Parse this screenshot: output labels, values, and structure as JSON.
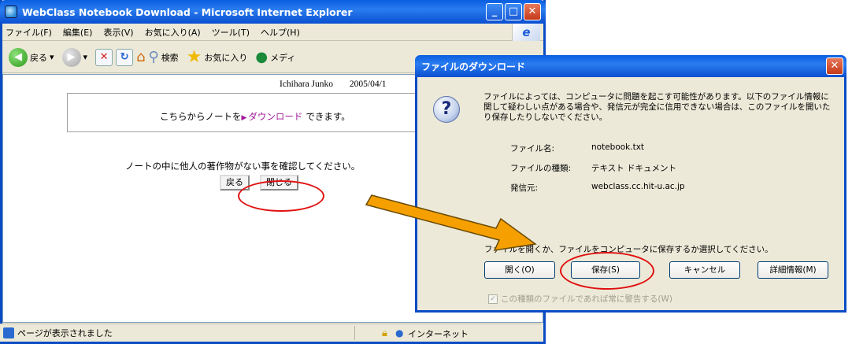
{
  "ie_window": {
    "title": "WebClass Notebook Download - Microsoft Internet Explorer",
    "menu": [
      "ファイル(F)",
      "編集(E)",
      "表示(V)",
      "お気に入り(A)",
      "ツール(T)",
      "ヘルプ(H)"
    ],
    "toolbar": {
      "back_label": "戻る",
      "search_label": "検索",
      "favorites_label": "お気に入り",
      "media_label": "メディ"
    },
    "content": {
      "user_name": "Ichihara Junko",
      "date": "2005/04/1",
      "note_prefix": "こちらからノートを",
      "download_link": "ダウンロード",
      "note_suffix": "できます。",
      "instruction": "ノートの中に他人の著作物がない事を確認してください。",
      "back_button": "戻る",
      "close_button": "閉じる"
    },
    "status": {
      "message": "ページが表示されました",
      "zone": "インターネット"
    }
  },
  "download_dialog": {
    "title": "ファイルのダウンロード",
    "message": "ファイルによっては、コンピュータに問題を起こす可能性があります。以下のファイル情報に関して疑わしい点がある場合や、発信元が完全に信用できない場合は、このファイルを開いたり保存したりしないでください。",
    "file_name_label": "ファイル名:",
    "file_name": "notebook.txt",
    "file_type_label": "ファイルの種類:",
    "file_type": "テキスト ドキュメント",
    "source_label": "発信元:",
    "source": "webclass.cc.hit-u.ac.jp",
    "prompt": "ファイルを開くか、ファイルをコンピュータに保存するか選択してください。",
    "buttons": {
      "open": "開く(O)",
      "save": "保存(S)",
      "cancel": "キャンセル",
      "details": "詳細情報(M)"
    },
    "always_ask": "この種類のファイルであれば常に警告する(W)"
  },
  "colors": {
    "title_bar": "#0a5fe0",
    "highlight_oval": "#e01010",
    "arrow": "#f5a000",
    "link": "#a01a9a"
  }
}
